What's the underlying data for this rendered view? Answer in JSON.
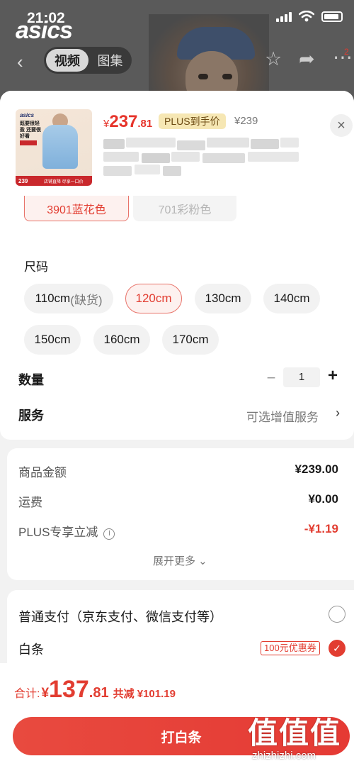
{
  "status_bar": {
    "time": "21:02"
  },
  "background_page": {
    "brand_logo": "asics",
    "tabs": [
      {
        "label": "视频",
        "active": true
      },
      {
        "label": "图集",
        "active": false
      }
    ],
    "cart_badge": "2"
  },
  "product": {
    "price_yen": "¥",
    "price_int": "237",
    "price_dec": ".81",
    "plus_badge": "PLUS到手价",
    "original_price": "¥239",
    "thumbnail": {
      "brand": "asics",
      "headline": "既要很轻盈 还要很好看",
      "bar_price": "239",
      "bar_text": "店铺直降 尽享一口价"
    }
  },
  "colors": [
    {
      "label": "3901蓝花色",
      "selected": true
    },
    {
      "label": "701彩粉色",
      "selected": false,
      "disabled": true
    }
  ],
  "size": {
    "label": "尺码",
    "options": [
      {
        "label": "110cm",
        "note": "(缺货)",
        "selected": false
      },
      {
        "label": "120cm",
        "note": "",
        "selected": true
      },
      {
        "label": "130cm",
        "note": "",
        "selected": false
      },
      {
        "label": "140cm",
        "note": "",
        "selected": false
      },
      {
        "label": "150cm",
        "note": "",
        "selected": false
      },
      {
        "label": "160cm",
        "note": "",
        "selected": false
      },
      {
        "label": "170cm",
        "note": "",
        "selected": false
      }
    ]
  },
  "quantity": {
    "label": "数量",
    "minus": "−",
    "value": "1",
    "plus": "+"
  },
  "service": {
    "label": "服务",
    "value": "可选增值服务",
    "arrow": "›"
  },
  "amounts": {
    "rows": [
      {
        "label": "商品金额",
        "value": "¥239.00"
      },
      {
        "label": "运费",
        "value": "¥0.00"
      },
      {
        "label": "PLUS专享立减",
        "value": "-¥1.19"
      }
    ],
    "expand_more": "展开更多 ⌄"
  },
  "payment": {
    "option_normal": "普通支付（京东支付、微信支付等）",
    "option_baitiao": "白条",
    "coupon_tag": "100元优惠券"
  },
  "footer": {
    "total_label": "合计:",
    "total_yen": "¥",
    "total_int": "137",
    "total_dec": ".81",
    "total_saved": "共减 ¥101.19",
    "pay_button": "打白条"
  },
  "watermark": {
    "big": "值值值",
    "small": "zhizhizhi.com"
  },
  "colors_theme": {
    "accent_red": "#e23d31",
    "plus_gold": "#f6e7b4",
    "sheet_bg": "#f2f2f2"
  }
}
